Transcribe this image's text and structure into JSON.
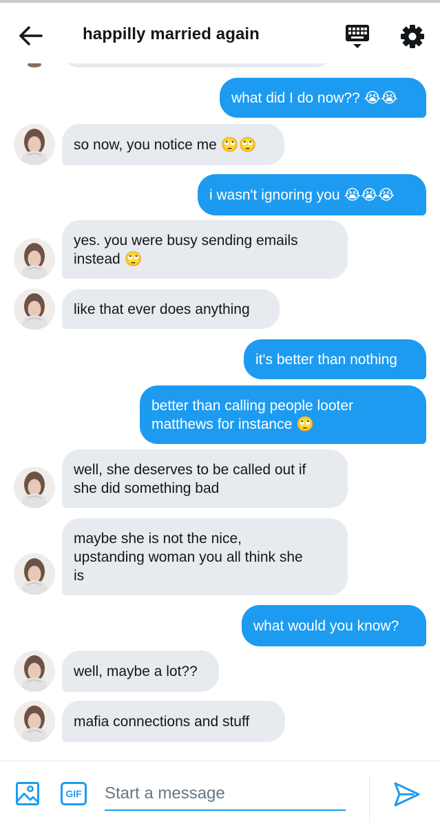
{
  "header": {
    "title": "happilly married again",
    "back_icon": "arrow-left-icon",
    "keyboard_icon": "keyboard-icon",
    "settings_icon": "gear-icon"
  },
  "colors": {
    "accent": "#1d9bf0",
    "incoming_bubble": "#e7ebef",
    "text": "#14171a",
    "placeholder": "#657786"
  },
  "messages": [
    {
      "dir": "out",
      "text": "what did I do now?? 😭😭"
    },
    {
      "dir": "in",
      "text": "so now, you notice me 🙄🙄"
    },
    {
      "dir": "out",
      "text": "i wasn't ignoring you 😭😭😭"
    },
    {
      "dir": "in",
      "text": "yes. you were busy sending emails\ninstead 🙄"
    },
    {
      "dir": "in",
      "text": "like that ever does anything"
    },
    {
      "dir": "out",
      "text": "it's better than nothing"
    },
    {
      "dir": "out",
      "text": "better than calling people looter\nmatthews for instance 🙄"
    },
    {
      "dir": "in",
      "text": "well, she deserves to be called out if\nshe did something bad"
    },
    {
      "dir": "in",
      "text": "maybe she is not the nice,\nupstanding woman you all think she\nis"
    },
    {
      "dir": "out",
      "text": "what would you know?"
    },
    {
      "dir": "in",
      "text": "well, maybe a lot??"
    },
    {
      "dir": "in",
      "text": "mafia connections and stuff"
    }
  ],
  "composer": {
    "placeholder": "Start a message",
    "media_icon": "image-icon",
    "gif_label": "GIF",
    "send_icon": "send-icon"
  }
}
